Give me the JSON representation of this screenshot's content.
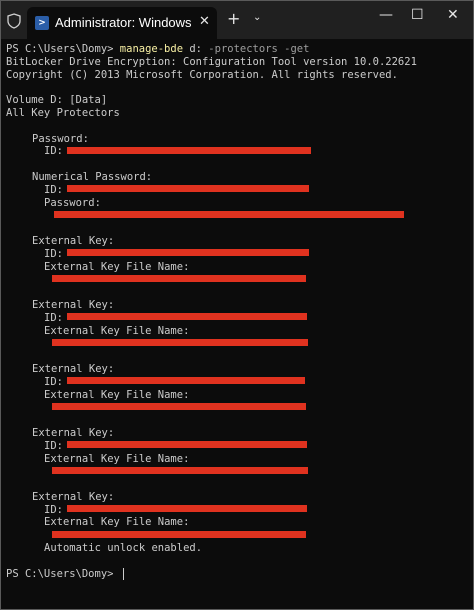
{
  "titlebar": {
    "tab_title": "Administrator: Windows PowerShell",
    "close_tab_glyph": "✕",
    "new_tab_glyph": "+",
    "dropdown_glyph": "⌄",
    "minimize_glyph": "—",
    "maximize_glyph": "☐",
    "close_glyph": "✕",
    "icons": [
      "shield-icon",
      "powershell-icon",
      "close-icon",
      "plus-icon",
      "chevron-down-icon",
      "minimize-icon",
      "maximize-icon",
      "close-window-icon"
    ]
  },
  "terminal": {
    "prompt1": "PS C:\\Users\\Domy> ",
    "cmd_name": "manage-bde",
    "cmd_args": " d:",
    "cmd_params": " -protectors -get",
    "banner1": "BitLocker Drive Encryption: Configuration Tool version 10.0.22621",
    "banner2": "Copyright (C) 2013 Microsoft Corporation. All rights reserved.",
    "volume": "Volume D: [Data]",
    "all_protectors": "All Key Protectors",
    "password_header": "Password:",
    "id_label": "ID:",
    "numerical_header": "Numerical Password:",
    "password_label": "Password:",
    "external_key_header": "External Key:",
    "ekfn_label": "External Key File Name:",
    "auto_unlock": "Automatic unlock enabled.",
    "prompt2": "PS C:\\Users\\Domy> "
  },
  "colors": {
    "background": "#0c0c0c",
    "text": "#cccccc",
    "command": "#f9f1a5",
    "parameter": "#9e9e9e",
    "redaction": "#e0321f",
    "titlebar": "#202020"
  }
}
